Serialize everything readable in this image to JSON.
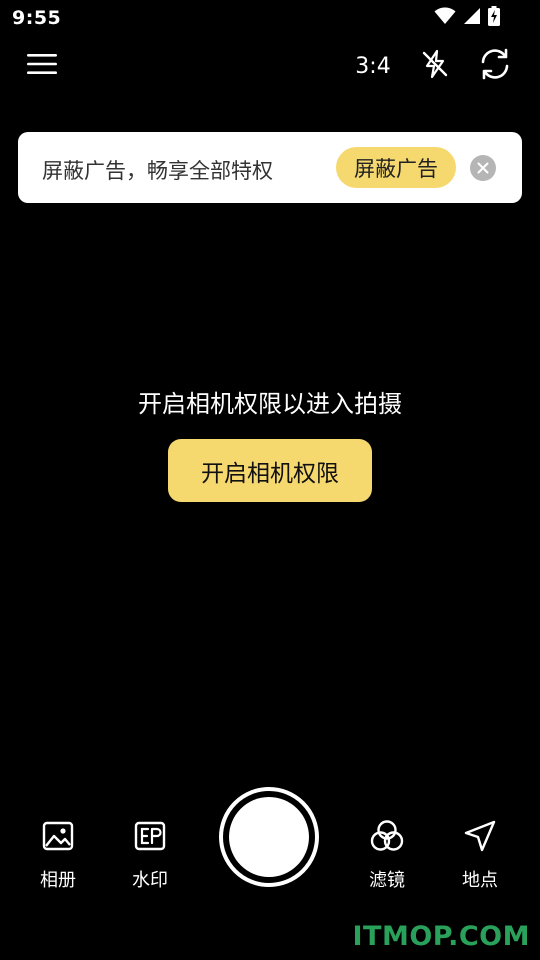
{
  "status_bar": {
    "time": "9:55",
    "icons": [
      "wifi-icon",
      "cell-signal-icon",
      "battery-charging-icon"
    ]
  },
  "toolbar": {
    "menu_icon": "menu-icon",
    "ratio_label": "3:4",
    "flash_icon": "flash-off-icon",
    "switch_icon": "camera-switch-icon"
  },
  "ad_banner": {
    "text": "屏蔽广告，畅享全部特权",
    "block_button_label": "屏蔽广告",
    "close_icon": "close-icon"
  },
  "permission": {
    "message": "开启相机权限以进入拍摄",
    "button_label": "开启相机权限"
  },
  "bottom_bar": {
    "album_label": "相册",
    "watermark_label": "水印",
    "filter_label": "滤镜",
    "location_label": "地点"
  },
  "branding": {
    "logo_text": "ITMOP.COM"
  },
  "colors": {
    "accent": "#f5d86e",
    "background": "#000000",
    "logo_green": "#2aa15a"
  }
}
